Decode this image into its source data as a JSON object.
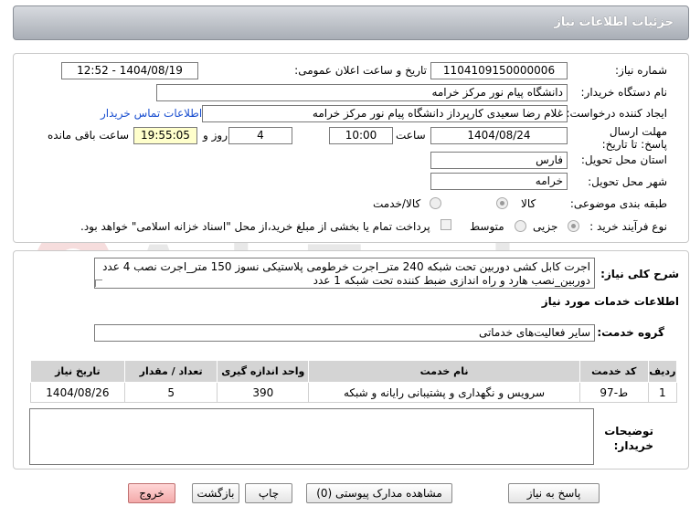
{
  "header": {
    "title": "جزئیات اطلاعات نیاز"
  },
  "form": {
    "need_number_label": "شماره نیاز:",
    "need_number": "1104109150000006",
    "announce_label": "تاریخ و ساعت اعلان عمومی:",
    "announce_value": "1404/08/19 - 12:52",
    "buyer_org_label": "نام دستگاه خریدار:",
    "buyer_org": "دانشگاه پیام نور مرکز خرامه",
    "requester_label": "ایجاد کننده درخواست:",
    "requester": "غلام رضا  سعیدی کارپرداز دانشگاه پیام نور مرکز خرامه",
    "contact_link": "اطلاعات تماس خریدار",
    "deadline_label": "مهلت ارسال پاسخ: تا تاریخ:",
    "deadline_date": "1404/08/24",
    "time_label": "ساعت",
    "deadline_time": "10:00",
    "days": "4",
    "days_label": "روز و",
    "remaining_time": "19:55:05",
    "remaining_label": "ساعت باقی مانده",
    "province_label": "استان محل تحویل:",
    "province": "فارس",
    "city_label": "شهر محل تحویل:",
    "city": "خرامه",
    "category_label": "طبقه بندی موضوعی:",
    "category_options": [
      "کالا",
      "کالا/خدمت"
    ],
    "process_label": "نوع فرآیند خرید :",
    "process_options": [
      "جزیی",
      "متوسط"
    ],
    "payment_note": "پرداخت تمام یا بخشی از مبلغ خرید،از محل \"اسناد خزانه اسلامی\" خواهد بود."
  },
  "summary": {
    "label": "شرح کلی نیاز:",
    "text": "اجرت کابل کشی دوربین تحت شبکه 240 متر_اجرت خرطومی پلاستیکی نسوز 150 متر_اجرت نصب 4 عدد دوربین_نصب هارد و راه اندازی ضبط کننده تحت شبکه 1 عدد"
  },
  "services": {
    "section_title": "اطلاعات خدمات مورد نیاز",
    "group_label": "گروه خدمت:",
    "group_value": "سایر فعالیت‌های خدماتی",
    "columns": [
      "ردیف",
      "کد خدمت",
      "نام خدمت",
      "واحد اندازه گیری",
      "تعداد / مقدار",
      "تاریخ نیاز"
    ],
    "rows": [
      [
        "1",
        "ط-97",
        "سرویس و نگهداری و پشتیبانی رایانه و شبکه",
        "390",
        "5",
        "1404/08/26"
      ]
    ]
  },
  "buyer_notes": {
    "label": "توضیحات خریدار:",
    "value": ""
  },
  "buttons": {
    "reply": "پاسخ به نیاز",
    "attachments": "مشاهده مدارک پیوستی (0)",
    "print": "چاپ",
    "back": "بازگشت",
    "exit": "خروج"
  },
  "watermark": {
    "text": "AriaTender.net"
  }
}
